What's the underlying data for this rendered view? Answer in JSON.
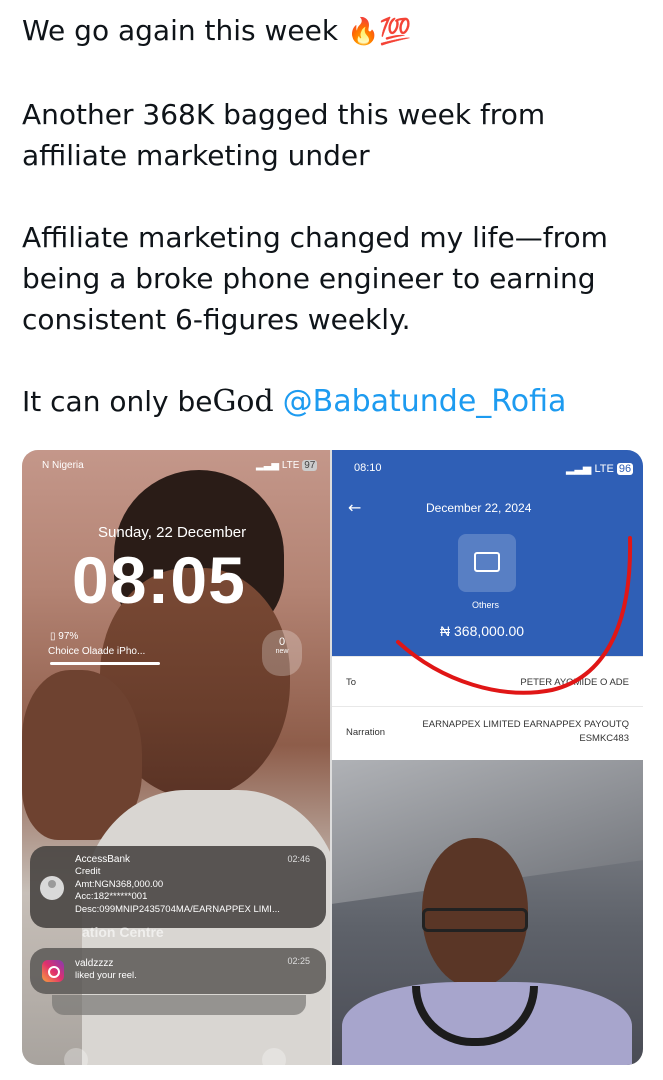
{
  "tweet": {
    "line1": "We go again this week",
    "line1_emoji": "🔥💯",
    "line2": "Another 368K bagged this week from",
    "line3": "affiliate marketing under",
    "line4": "Affiliate marketing changed my life—from",
    "line5": "being a broke phone engineer to earning",
    "line6": "consistent 6-figures weekly.",
    "line7_prefix": "It can only be",
    "line7_god": "God",
    "mention": "@Babatunde_Rofia"
  },
  "lockscreen": {
    "carrier": "N Nigeria",
    "signal": "LTE",
    "battery_badge": "97",
    "date": "Sunday, 22 December",
    "time": "08:05",
    "battery_pct": "97%",
    "device_name": "Choice Olaade iPho...",
    "pill_count": "0",
    "pill_label": "new",
    "centre_label": "ation Centre",
    "notification_bank": {
      "app": "AccessBank",
      "time": "02:46",
      "lines": [
        "Credit",
        "Amt:NGN368,000.00",
        "Acc:182******001",
        "Desc:099MNIP2435704MA/EARNAPPEX LIMI..."
      ]
    },
    "notification_instagram": {
      "app": "valdzzzz",
      "time": "02:25",
      "text": "liked your reel."
    }
  },
  "receipt": {
    "time": "08:10",
    "signal": "LTE",
    "battery_badge": "96",
    "date": "December 22, 2024",
    "category": "Others",
    "amount": "₦ 368,000.00",
    "to_label": "To",
    "to_value": "PETER AYOMIDE O   ADE",
    "narration_label": "Narration",
    "narration_value_line1": "EARNAPPEX LIMITED EARNAPPEX PAYOUTQ",
    "narration_value_line2": "ESMKC483",
    "accent_color": "#2f5fb6",
    "annotation_color": "#e01616"
  }
}
